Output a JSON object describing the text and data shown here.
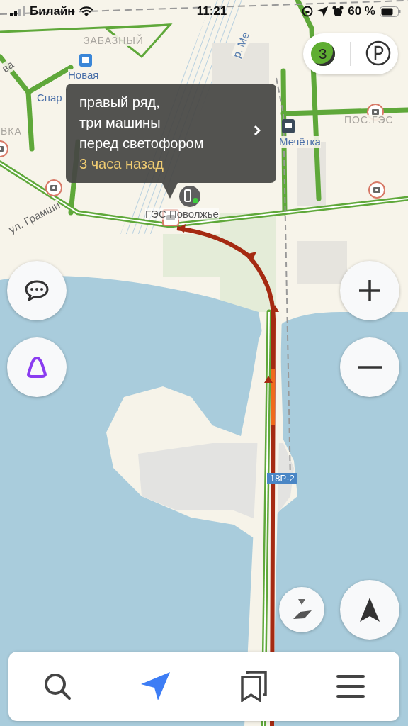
{
  "status_bar": {
    "carrier": "Билайн",
    "time": "11:21",
    "battery": "60 %"
  },
  "map": {
    "labels": [
      {
        "text": "ва",
        "kind": "street"
      },
      {
        "text": "ЗАБАЗНЫЙ",
        "kind": "district"
      },
      {
        "text": "р. Ме",
        "kind": "water"
      },
      {
        "text": "Новая",
        "kind": "stop"
      },
      {
        "text": "Спар",
        "kind": "stop"
      },
      {
        "text": "ВКА",
        "kind": "district"
      },
      {
        "text": "Мечётка",
        "kind": "stop"
      },
      {
        "text": "ПОС.ГЭС",
        "kind": "district"
      },
      {
        "text": "ГЭС Поволжье",
        "kind": "place"
      },
      {
        "text": "ул. Грамши",
        "kind": "street"
      },
      {
        "text": "18Р-2",
        "kind": "shield"
      }
    ]
  },
  "traffic": {
    "score": "3",
    "color": "#5fae32"
  },
  "callout": {
    "text": "правый ряд,\nтри машины\nперед светофором",
    "time": "3 часа назад"
  },
  "nav": [
    {
      "kind": "search",
      "selected": false
    },
    {
      "kind": "route",
      "selected": true
    },
    {
      "kind": "bookmarks",
      "selected": false
    },
    {
      "kind": "menu",
      "selected": false
    }
  ]
}
